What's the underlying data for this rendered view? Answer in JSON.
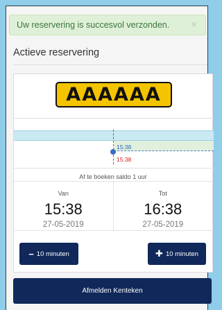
{
  "alert": {
    "message": "Uw reservering is succesvol verzonden.",
    "close_symbol": "×"
  },
  "section": {
    "title": "Actieve reservering"
  },
  "reservation": {
    "plate": "AAAAAA",
    "timeline": {
      "start_label": "15:38",
      "now_label": "15:38"
    },
    "saldo_text": "Af te boeken saldo 1 uur",
    "van": {
      "label": "Van",
      "time": "15:38",
      "date": "27-05-2019"
    },
    "tot": {
      "label": "Tot",
      "time": "16:38",
      "date": "27-05-2019"
    },
    "minus_button": {
      "icon": "−",
      "label": "10 minuten"
    },
    "plus_button": {
      "icon": "✚",
      "label": "10 minuten"
    }
  },
  "actions": {
    "afmelden_label": "Afmelden Kenteken"
  },
  "colors": {
    "background": "#8fcde8",
    "alert_bg": "#dff0d8",
    "alert_text": "#3c763d",
    "plate_yellow": "#f5c400",
    "navy": "#10285a",
    "timeline_blue": "#2a62b8",
    "timeline_red": "#cc2222"
  }
}
